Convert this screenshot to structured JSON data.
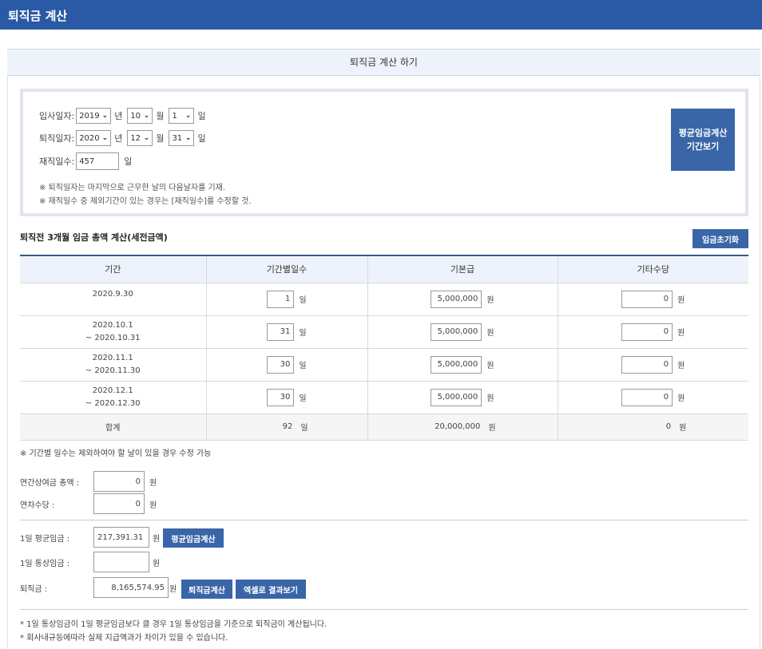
{
  "header": {
    "title": "퇴직금 계산"
  },
  "section": {
    "title": "퇴직금 계산 하기"
  },
  "dates": {
    "join_label": "입사일자:",
    "join_year": "2019",
    "join_month": "10",
    "join_day": "1",
    "leave_label": "퇴직일자:",
    "leave_year": "2020",
    "leave_month": "12",
    "leave_day": "31",
    "unit_year": "년",
    "unit_month": "월",
    "unit_day": "일",
    "tenure_label": "재직일수:",
    "tenure_value": "457",
    "tenure_unit": "일",
    "note1": "※ 퇴직일자는 마지막으로 근무한 날의 다음날자를 기재.",
    "note2": "※ 재직일수 중 제외기간이 있는 경우는 [재직일수]를 수정할 것.",
    "avg_period_button_line1": "평균임금계산",
    "avg_period_button_line2": "기간보기"
  },
  "wage": {
    "title": "퇴직전 3개월 임금 총액 계산(세전금액)",
    "reset_button": "임금초기화",
    "headers": [
      "기간",
      "기간별일수",
      "기본급",
      "기타수당"
    ],
    "rows": [
      {
        "period_line1": "2020.9.30",
        "period_line2": "",
        "days": "1",
        "base": "5,000,000",
        "other": "0"
      },
      {
        "period_line1": "2020.10.1",
        "period_line2": "~ 2020.10.31",
        "days": "31",
        "base": "5,000,000",
        "other": "0"
      },
      {
        "period_line1": "2020.11.1",
        "period_line2": "~ 2020.11.30",
        "days": "30",
        "base": "5,000,000",
        "other": "0"
      },
      {
        "period_line1": "2020.12.1",
        "period_line2": "~ 2020.12.30",
        "days": "30",
        "base": "5,000,000",
        "other": "0"
      }
    ],
    "total_label": "합계",
    "total_days": "92",
    "total_base": "20,000,000",
    "total_other": "0",
    "unit_day": "일",
    "unit_won": "원"
  },
  "form": {
    "note": "※ 기간별 일수는 제외하여야 할 날이 있을 경우 수정 가능",
    "bonus_label": "연간상여금 총액 :",
    "bonus_value": "0",
    "leave_pay_label": "연차수당 :",
    "leave_pay_value": "0",
    "avg_wage_label": "1일 평균임금 :",
    "avg_wage_value": "217,391.31",
    "avg_wage_button": "평균임금계산",
    "ordinary_wage_label": "1일 통상임금 :",
    "ordinary_wage_value": "",
    "severance_label": "퇴직금 :",
    "severance_value": "8,165,574.95",
    "severance_button": "퇴직금계산",
    "excel_button": "엑셀로 결과보기",
    "unit_won": "원"
  },
  "footer": {
    "note1": "* 1일 통상임금이 1일 평균임금보다 클 경우 1일 통상임금을 기준으로 퇴직금이 계산됩니다.",
    "note2": "* 회사내규등에따라 실제 지급액과가 차이가 있을 수 있습니다."
  }
}
